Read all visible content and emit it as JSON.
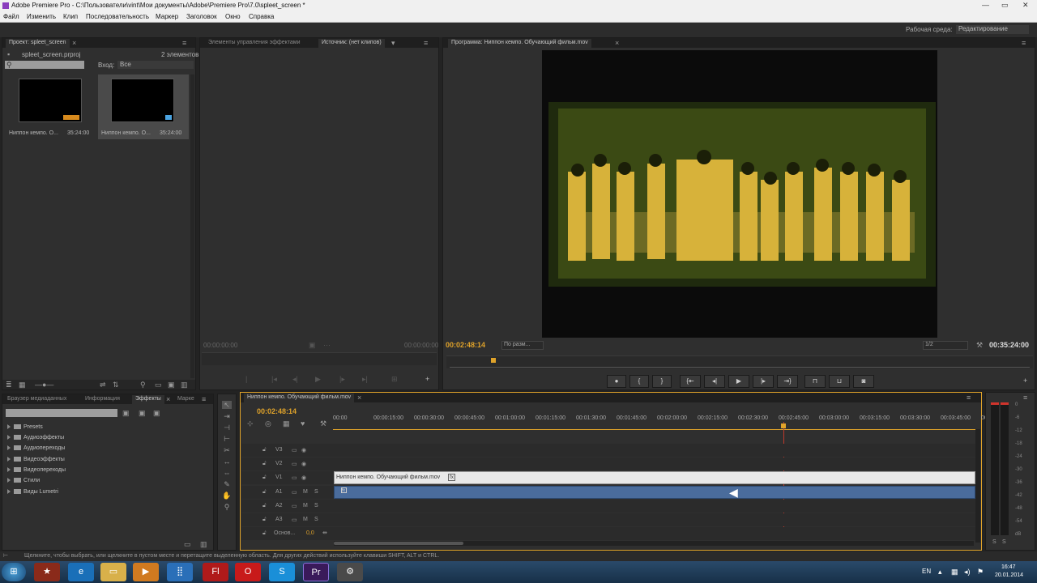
{
  "window": {
    "title": "Adobe Premiere Pro - C:\\Пользователи\\vint\\Мои документы\\Adobe\\Premiere Pro\\7.0\\spleet_screen *"
  },
  "menu": [
    "Файл",
    "Изменить",
    "Клип",
    "Последовательность",
    "Маркер",
    "Заголовок",
    "Окно",
    "Справка"
  ],
  "workspace": {
    "label": "Рабочая среда:",
    "value": "Редактирование"
  },
  "project": {
    "tab": "Проект: spleet_screen",
    "file": "spleet_screen.prproj",
    "count": "2 элементов",
    "input_label": "Вход:",
    "input_value": "Все",
    "clips": [
      {
        "name": "Ниппон кемпо. О...",
        "duration": "35:24:00"
      },
      {
        "name": "Ниппон кемпо. О...",
        "duration": "35:24:00"
      }
    ]
  },
  "source": {
    "tab_fx": "Элементы управления эффектами",
    "tab_src": "Источник: (нет клипов)",
    "tc_left": "00:00:00:00",
    "tc_right": "00:00:00:00"
  },
  "program": {
    "tab": "Программа: Ниппон кемпо. Обучающий фильм.mov",
    "tc": "00:02:48:14",
    "fit": "По разм...",
    "quality": "1/2",
    "duration": "00:35:24:00"
  },
  "effects": {
    "tabs": [
      "Браузер медиаданных",
      "Информация",
      "Эффекты",
      "Марке"
    ],
    "tree": [
      "Presets",
      "Аудиоэффекты",
      "Аудиопереходы",
      "Видеоэффекты",
      "Видеопереходы",
      "Стили",
      "Виды Lumetri"
    ]
  },
  "timeline": {
    "tab": "Ниппон кемпо. Обучающий фильм.mov",
    "tc": "00:02:48:14",
    "ruler": [
      "00:00",
      "00:00:15:00",
      "00:00:30:00",
      "00:00:45:00",
      "00:01:00:00",
      "00:01:15:00",
      "00:01:30:00",
      "00:01:45:00",
      "00:02:00:00",
      "00:02:15:00",
      "00:02:30:00",
      "00:02:45:00",
      "00:03:00:00",
      "00:03:15:00",
      "00:03:30:00",
      "00:03:45:00",
      "00:0"
    ],
    "tracks": [
      "V3",
      "V2",
      "V1",
      "A1",
      "A2",
      "A3"
    ],
    "clip_label": "Ниппон кемпо. Обучающий фильм.mov",
    "master_label": "Основ...",
    "master_value": "0,0",
    "playhead_fraction": 0.7
  },
  "meter": {
    "scale": [
      "0",
      "-6",
      "-12",
      "-18",
      "-24",
      "-30",
      "-36",
      "-42",
      "-48",
      "-54",
      "dB"
    ]
  },
  "status": {
    "text": "Щелкните, чтобы выбрать, или щелкните в пустом месте и перетащите выделенную область. Для других действий используйте клавиши SHIFT, ALT и CTRL."
  },
  "taskbar": {
    "lang": "EN",
    "time": "16:47",
    "date": "20.01.2014"
  }
}
